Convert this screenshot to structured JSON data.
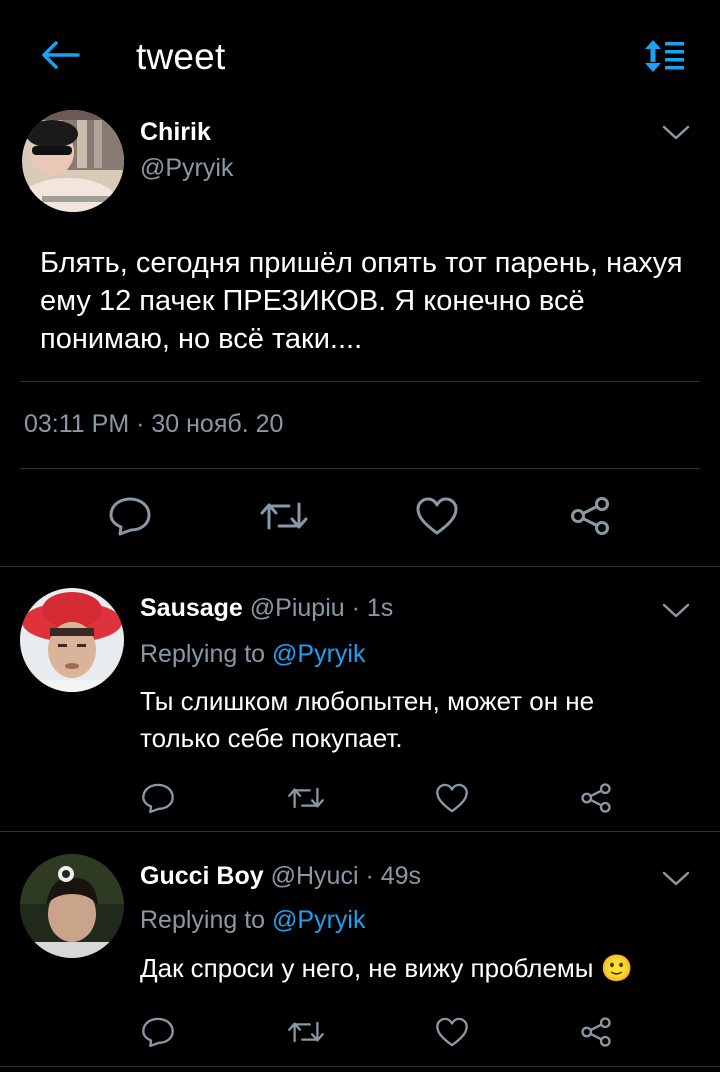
{
  "header": {
    "title": "tweet"
  },
  "main_tweet": {
    "author_name": "Chirik",
    "author_handle": "@Pyryik",
    "text": "Блять, сегодня пришёл опять тот парень, нахуя ему 12 пачек ПРЕЗИКОВ. Я конечно всё понимаю, но всё таки....",
    "time": "03:11 PM · 30 нояб. 20"
  },
  "replies": [
    {
      "author_name": "Sausage",
      "author_handle": "@Piupiu",
      "age": "· 1s",
      "replying_prefix": "Replying to",
      "replying_handle": "@Pyryik",
      "text": "Ты слишком любопытен, может он не только себе покупает."
    },
    {
      "author_name": "Gucci Boy",
      "author_handle": "@Hyuci",
      "age": "· 49s",
      "replying_prefix": "Replying to",
      "replying_handle": "@Pyryik",
      "text": "Дак спроси у него, не вижу проблемы 🙂"
    }
  ],
  "colors": {
    "accent": "#1da1f2",
    "secondary_text": "#8899a6",
    "background": "#000000"
  },
  "icons": [
    "back-arrow-icon",
    "sort-icon",
    "chevron-down-icon",
    "reply-icon",
    "retweet-icon",
    "like-icon",
    "share-icon"
  ]
}
